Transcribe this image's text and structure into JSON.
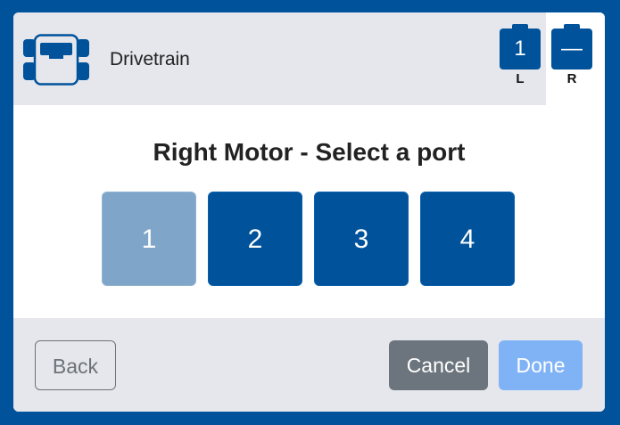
{
  "header": {
    "title": "Drivetrain",
    "icon": "drivetrain-icon",
    "ports": [
      {
        "value": "1",
        "label": "L"
      },
      {
        "value": "—",
        "label": "R"
      }
    ]
  },
  "main": {
    "title": "Right Motor - Select a port",
    "ports": [
      "1",
      "2",
      "3",
      "4"
    ]
  },
  "footer": {
    "back_label": "Back",
    "cancel_label": "Cancel",
    "done_label": "Done"
  },
  "colors": {
    "primary": "#00529a",
    "disabled_port": "#7fa6c9",
    "cancel": "#6c757d",
    "done_disabled": "#80b3f6"
  }
}
